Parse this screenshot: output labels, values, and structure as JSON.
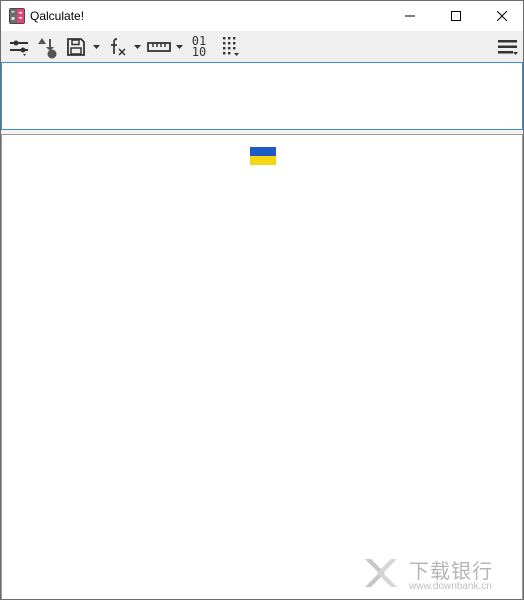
{
  "window": {
    "title": "Qalculate!",
    "controls": {
      "minimize_icon": "minimize-icon",
      "maximize_icon": "maximize-icon",
      "close_icon": "close-icon"
    }
  },
  "toolbar": {
    "items": [
      {
        "icon": "settings-sliders-icon",
        "has_menu": false
      },
      {
        "icon": "store-variable-icon",
        "has_menu": false
      },
      {
        "icon": "save-icon",
        "has_menu": true
      },
      {
        "icon": "functions-icon",
        "label": "fx",
        "has_menu": true
      },
      {
        "icon": "units-ruler-icon",
        "has_menu": true
      },
      {
        "icon": "number-base-icon",
        "label_top": "01",
        "label_bottom": "10",
        "has_menu": false
      },
      {
        "icon": "keypad-icon",
        "has_menu": false
      },
      {
        "icon": "main-menu-icon",
        "has_menu": false
      }
    ]
  },
  "expression": {
    "value": "",
    "placeholder": ""
  },
  "result": {
    "value": "",
    "flag_icon": "ukraine-flag-icon",
    "flag_colors": [
      "#1f5bc6",
      "#f6d512"
    ]
  },
  "watermark": {
    "text": "下载银行",
    "url": "www.downbank.cn"
  }
}
